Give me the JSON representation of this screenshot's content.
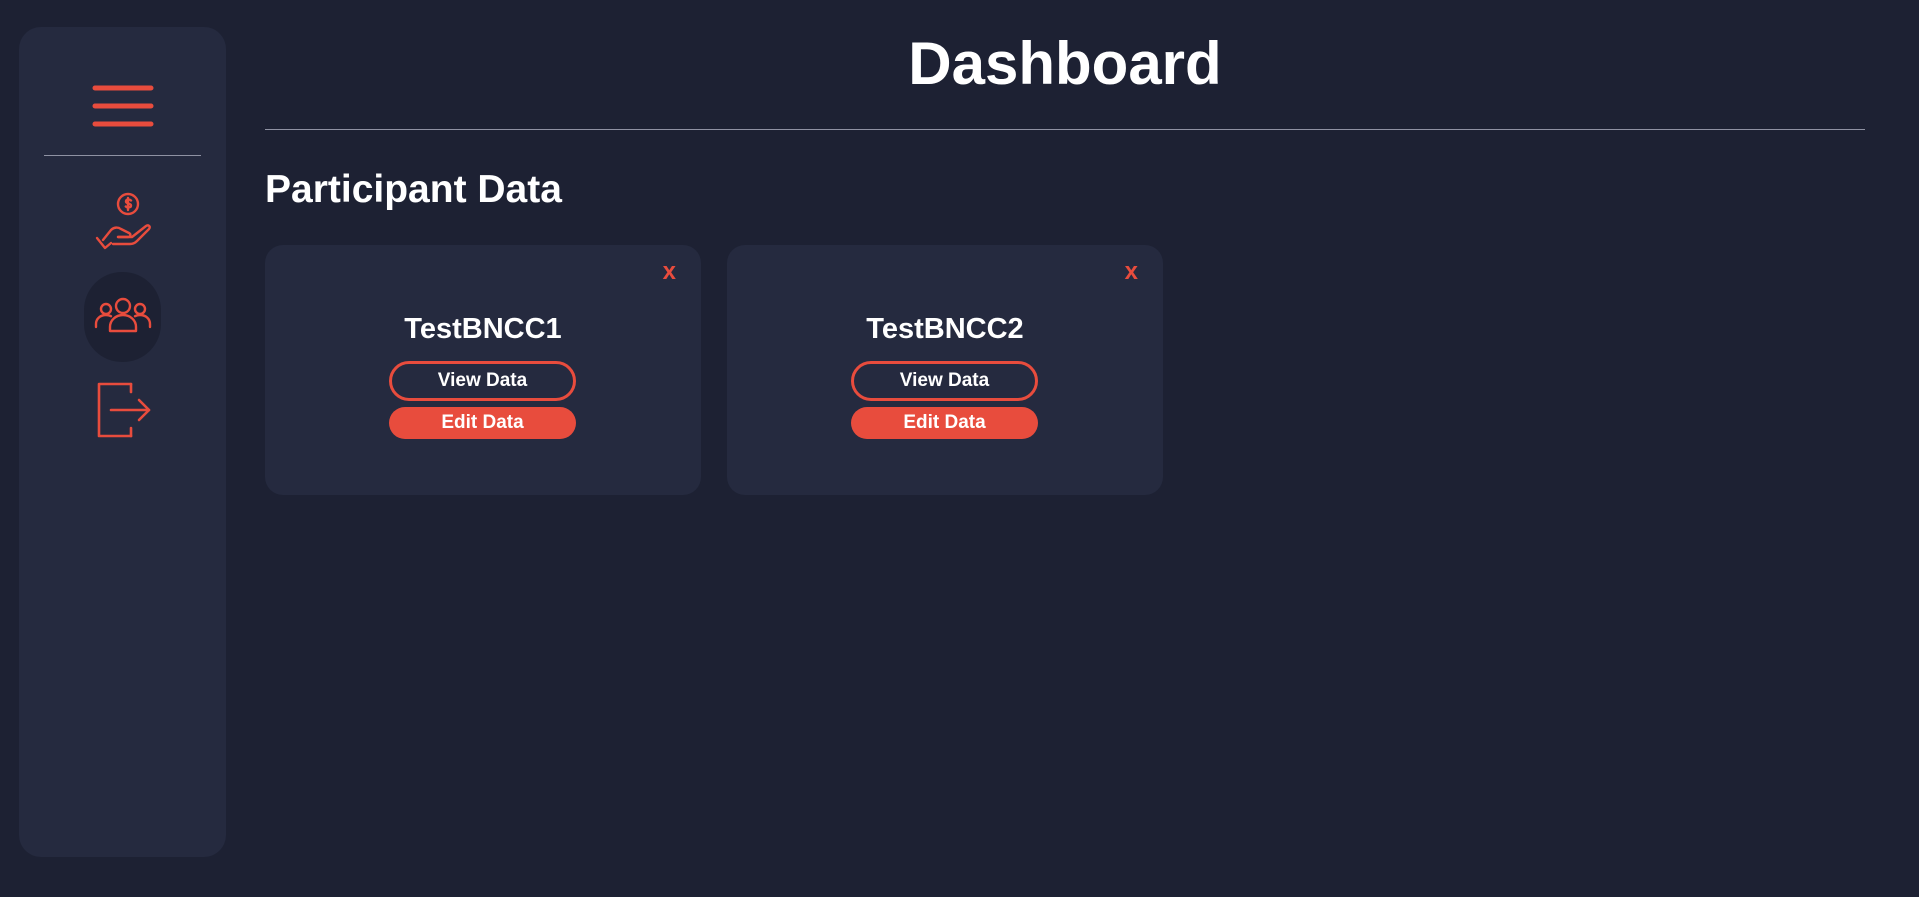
{
  "header": {
    "title": "Dashboard"
  },
  "section": {
    "title": "Participant Data"
  },
  "sidebar": {
    "items": [
      {
        "name": "funds",
        "icon": "hand-coin-icon"
      },
      {
        "name": "participants",
        "icon": "group-icon",
        "active": true
      },
      {
        "name": "logout",
        "icon": "logout-icon"
      }
    ]
  },
  "cards": [
    {
      "name": "TestBNCC1",
      "close_label": "x",
      "view_label": "View Data",
      "edit_label": "Edit Data"
    },
    {
      "name": "TestBNCC2",
      "close_label": "x",
      "view_label": "View Data",
      "edit_label": "Edit Data"
    }
  ],
  "colors": {
    "background": "#1d2133",
    "panel": "#252a3f",
    "accent": "#e84c3d",
    "divider": "#8f92a3",
    "text": "#ffffff"
  }
}
